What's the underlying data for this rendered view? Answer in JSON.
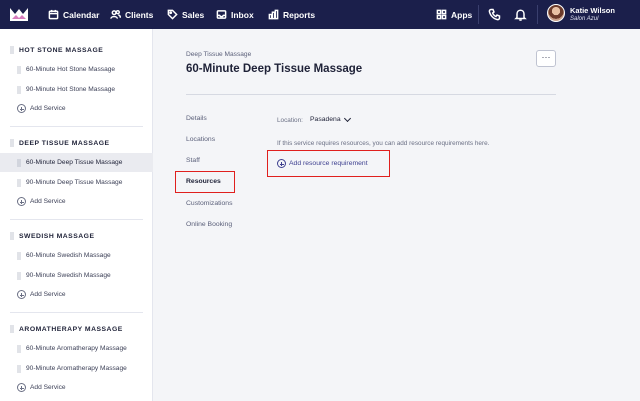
{
  "nav": {
    "items": [
      {
        "label": "Calendar",
        "icon": "calendar-icon"
      },
      {
        "label": "Clients",
        "icon": "users-icon"
      },
      {
        "label": "Sales",
        "icon": "tag-icon"
      },
      {
        "label": "Inbox",
        "icon": "inbox-icon"
      },
      {
        "label": "Reports",
        "icon": "bar-chart-icon"
      }
    ],
    "apps_label": "Apps",
    "user": {
      "name": "Katie Wilson",
      "business": "Salon Azul"
    }
  },
  "sidebar": {
    "categories": [
      {
        "title": "HOT STONE MASSAGE",
        "services": [
          "60-Minute Hot Stone Massage",
          "90-Minute Hot Stone Massage"
        ],
        "add_label": "Add Service"
      },
      {
        "title": "DEEP TISSUE MASSAGE",
        "services": [
          "60-Minute Deep Tissue Massage",
          "90-Minute Deep Tissue Massage"
        ],
        "add_label": "Add Service"
      },
      {
        "title": "SWEDISH MASSAGE",
        "services": [
          "60-Minute Swedish Massage",
          "90-Minute Swedish Massage"
        ],
        "add_label": "Add Service"
      },
      {
        "title": "AROMATHERAPY MASSAGE",
        "services": [
          "60-Minute Aromatherapy Massage",
          "90-Minute Aromatherapy Massage"
        ],
        "add_label": "Add Service"
      }
    ],
    "selected_service": "60-Minute Deep Tissue Massage"
  },
  "main": {
    "breadcrumb": "Deep Tissue Massage",
    "title": "60-Minute Deep Tissue Massage",
    "more_label": "···",
    "tabs": [
      "Details",
      "Locations",
      "Staff",
      "Resources",
      "Customizations",
      "Online Booking"
    ],
    "active_tab": "Resources",
    "location_label": "Location:",
    "location_value": "Pasadena",
    "info_text": "If this service requires resources, you can add resource requirements here.",
    "add_requirement_label": "Add resource requirement"
  },
  "colors": {
    "nav_bg": "#1b1f4b",
    "accent": "#3d3f8f",
    "highlight": "#e0201e",
    "main_bg": "#f4f5f8"
  }
}
